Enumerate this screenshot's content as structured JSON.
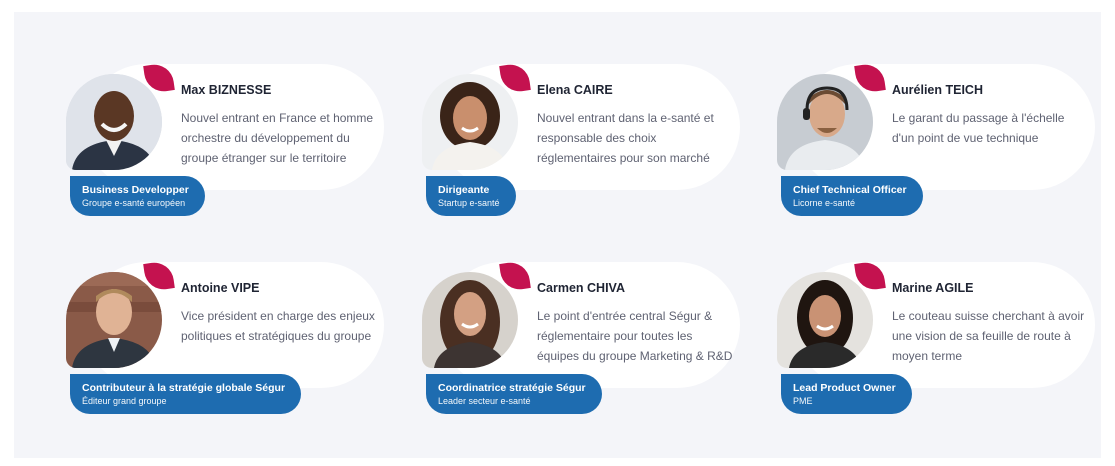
{
  "colors": {
    "accent": "#c4124f",
    "badge": "#1e6cb0",
    "background": "#f4f5f9"
  },
  "personas": [
    {
      "name": "Max BIZNESSE",
      "description": "Nouvel entrant en France et homme orchestre du développement du groupe étranger sur le territoire",
      "role": "Business Developper",
      "organization": "Groupe e-santé européen"
    },
    {
      "name": "Elena CAIRE",
      "description": "Nouvel entrant dans la e-santé et responsable des choix réglementaires pour son marché",
      "role": "Dirigeante",
      "organization": "Startup e-santé"
    },
    {
      "name": "Aurélien TEICH",
      "description": "Le garant du passage à l'échelle d'un point de vue technique",
      "role": "Chief Technical Officer",
      "organization": "Licorne e-santé"
    },
    {
      "name": "Antoine VIPE",
      "description": "Vice président en charge des enjeux politiques et stratégiques du groupe",
      "role": "Contributeur à la stratégie globale Ségur",
      "organization": "Éditeur grand groupe"
    },
    {
      "name": "Carmen CHIVA",
      "description": "Le point d'entrée central Ségur & réglementaire pour toutes les équipes du groupe Marketing & R&D",
      "role": "Coordinatrice stratégie Ségur",
      "organization": "Leader secteur e-santé"
    },
    {
      "name": "Marine AGILE",
      "description": "Le couteau suisse cherchant à avoir une vision de sa feuille de route à moyen terme",
      "role": "Lead Product Owner",
      "organization": "PME"
    }
  ]
}
